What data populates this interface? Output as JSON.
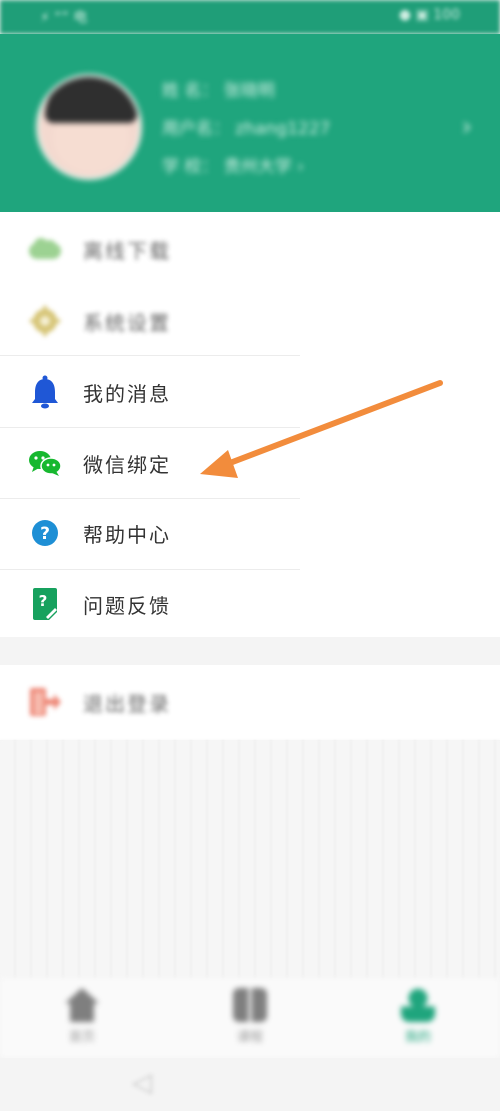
{
  "status_bar": {
    "left": "⚡ “” 电",
    "right": "● ▣ 100"
  },
  "profile": {
    "line1": "姓    名： 张晓明",
    "line2": "用户名： zhang1227",
    "line3": "学    校： 贵州大学 ›",
    "chevron": "›"
  },
  "menu": {
    "items": [
      {
        "label": "离线下载",
        "icon": "cloud-download-icon",
        "blurred": true
      },
      {
        "label": "系统设置",
        "icon": "gear-icon",
        "blurred": true
      },
      {
        "label": "我的消息",
        "icon": "bell-icon",
        "blurred": false
      },
      {
        "label": "微信绑定",
        "icon": "wechat-icon",
        "blurred": false
      },
      {
        "label": "帮助中心",
        "icon": "question-icon",
        "blurred": false
      },
      {
        "label": "问题反馈",
        "icon": "feedback-icon",
        "blurred": false
      }
    ]
  },
  "logout": {
    "label": "退出登录",
    "icon": "logout-icon"
  },
  "bottom_nav": {
    "tabs": [
      {
        "label": "首页",
        "icon": "home-icon"
      },
      {
        "label": "课程",
        "icon": "grid-icon"
      },
      {
        "label": "我的",
        "icon": "person-icon"
      }
    ]
  },
  "system_nav": {
    "back": "◁"
  },
  "colors": {
    "header_green": "#1fa57d",
    "bell_blue": "#1f57d6",
    "wechat_green": "#17b82f",
    "help_blue": "#1e8fd5",
    "feedback_green": "#17a15e",
    "logout_red": "#e8604a",
    "arrow_orange": "#f28c3c"
  }
}
